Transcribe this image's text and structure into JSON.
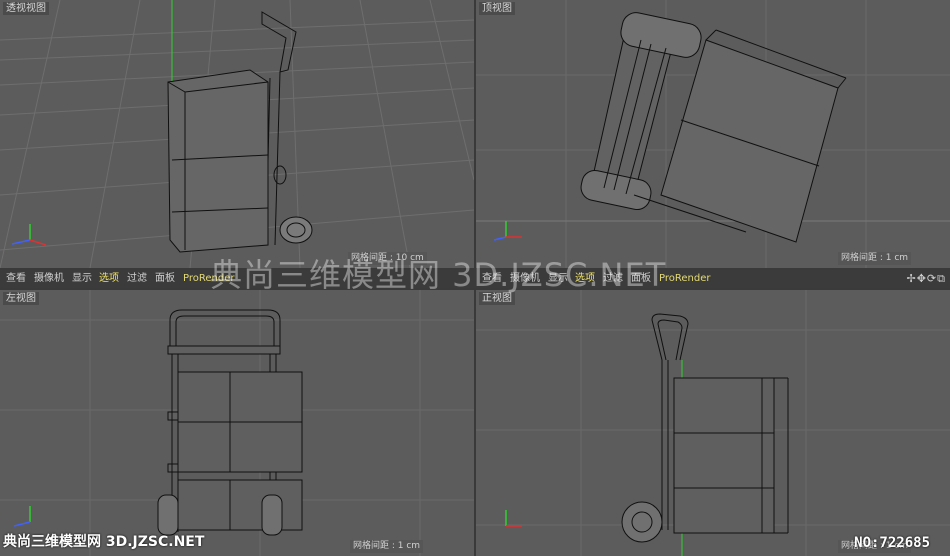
{
  "viewports": {
    "perspective": {
      "title": "透视视图",
      "grid_spacing": "网格间距 : 10 cm"
    },
    "top": {
      "title": "顶视图",
      "grid_spacing": "网格间距 : 1 cm"
    },
    "left": {
      "title": "左视图",
      "grid_spacing": "网格间距 : 1 cm"
    },
    "front": {
      "title": "正视图",
      "grid_spacing": "网格间距 : 1 cm"
    }
  },
  "menubar_left": [
    "查看",
    "摄像机",
    "显示",
    "选项",
    "过滤",
    "面板",
    "ProRender"
  ],
  "menubar_right": [
    "查看",
    "摄像机",
    "显示",
    "选项",
    "过滤",
    "面板",
    "ProRender"
  ],
  "nav_icons": [
    "move-icon",
    "pan-icon",
    "rotate-icon",
    "maximize-icon"
  ],
  "nav_glyphs": "✢✥⟳⧉",
  "watermark": "典尚三维模型网 3D.JZSC.NET",
  "footer_site": "典尚三维模型网 3D.JZSC.NET",
  "footer_id": "NO:722685",
  "colors": {
    "viewport_bg": "#5c5c5c",
    "grid": "#6e6e6e",
    "wire": "#101010",
    "axis_x": "#e03030",
    "axis_y": "#30d030",
    "axis_z": "#4060ff",
    "highlight": "#f0e36a"
  }
}
